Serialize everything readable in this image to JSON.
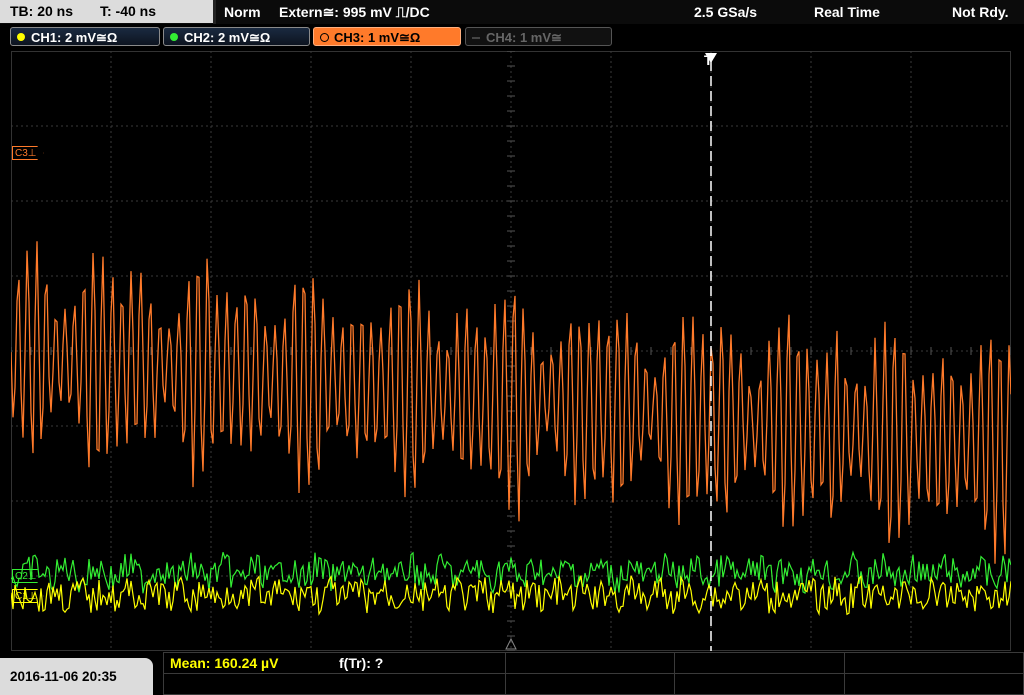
{
  "header": {
    "timebase": "TB: 20 ns",
    "trigger_offset": "T: -40 ns",
    "mode": "Norm",
    "trigger_source": "Extern≅: 995 mV ⎍/DC",
    "sample_rate": "2.5 GSa/s",
    "acq_mode": "Real Time",
    "status": "Not Rdy."
  },
  "channels": [
    {
      "label": "CH1: 2 mV≅Ω",
      "color": "#ffff00",
      "state": "on"
    },
    {
      "label": "CH2: 2 mV≅Ω",
      "color": "#33ee33",
      "state": "on"
    },
    {
      "label": "CH3: 1 mV≅Ω",
      "color": "#ff7a2a",
      "state": "active"
    },
    {
      "label": "CH4: 1 mV≅",
      "color": "#666666",
      "state": "off"
    }
  ],
  "markers": {
    "ch3_marker": "C3⊥",
    "ch2_marker": "C2⊥",
    "ch1_marker": "C1⊥",
    "trigger_marker": "T"
  },
  "footer": {
    "datetime": "2016-11-06 20:35",
    "measurement_mean": "Mean: 160.24 µV",
    "measurement_freq": "f(Tr): ?"
  },
  "colors": {
    "grid": "#3a3a3a",
    "ch1": "#ffff00",
    "ch2": "#33ee33",
    "ch3": "#ff7a2a"
  }
}
